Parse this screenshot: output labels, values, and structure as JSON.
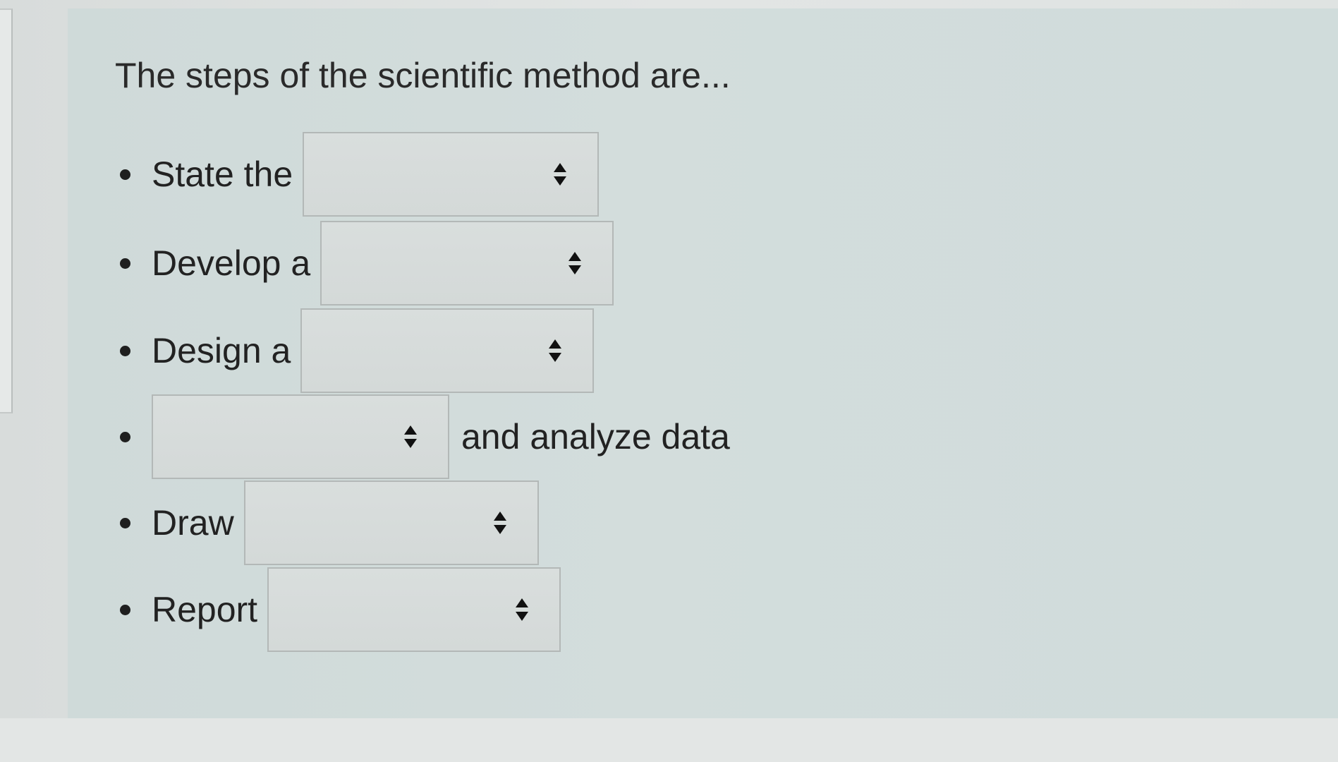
{
  "question": "The steps of the scientific method are...",
  "steps": [
    {
      "before": "State the",
      "value": "",
      "after": ""
    },
    {
      "before": "Develop a",
      "value": "",
      "after": ""
    },
    {
      "before": "Design a",
      "value": "",
      "after": ""
    },
    {
      "before": "",
      "value": "",
      "after": "and analyze data"
    },
    {
      "before": "Draw",
      "value": "",
      "after": ""
    },
    {
      "before": "Report",
      "value": "",
      "after": ""
    }
  ],
  "icons": {
    "bullet": "bullet-dot-icon",
    "select_arrows": "up-down-arrows-icon"
  }
}
